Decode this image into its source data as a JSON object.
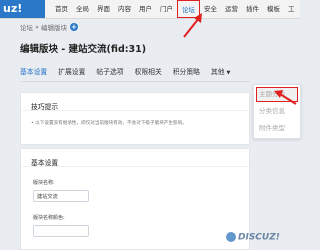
{
  "logo": "uz!",
  "nav": [
    "首页",
    "全局",
    "界面",
    "内容",
    "用户",
    "门户",
    "论坛",
    "安全",
    "运营",
    "插件",
    "模板",
    "工"
  ],
  "nav_active_index": 6,
  "breadcrumb": {
    "parent": "论坛",
    "sep": "»",
    "current": "编辑版块"
  },
  "title": "编辑版块 - 建站交流(fid:31)",
  "tabs": [
    "基本设置",
    "扩展设置",
    "帖子选项",
    "权限相关",
    "积分策略",
    "其他"
  ],
  "dropdown": [
    "主题分类",
    "分类信息",
    "附件类型"
  ],
  "panel1": {
    "header": "技巧提示",
    "tip": "以下设置没有继承性，即仅对当前版块有效，不会对下级子版块产生影响。"
  },
  "panel2": {
    "header": "基本设置",
    "field1_label": "版块名称:",
    "field1_value": "建站交流",
    "field2_label": "版块名称颜色:"
  },
  "watermark": "DISCUZ!",
  "colors": {
    "accent": "#1f6fc4",
    "highlight": "#e02020",
    "logo_bg": "#2a78c7"
  }
}
